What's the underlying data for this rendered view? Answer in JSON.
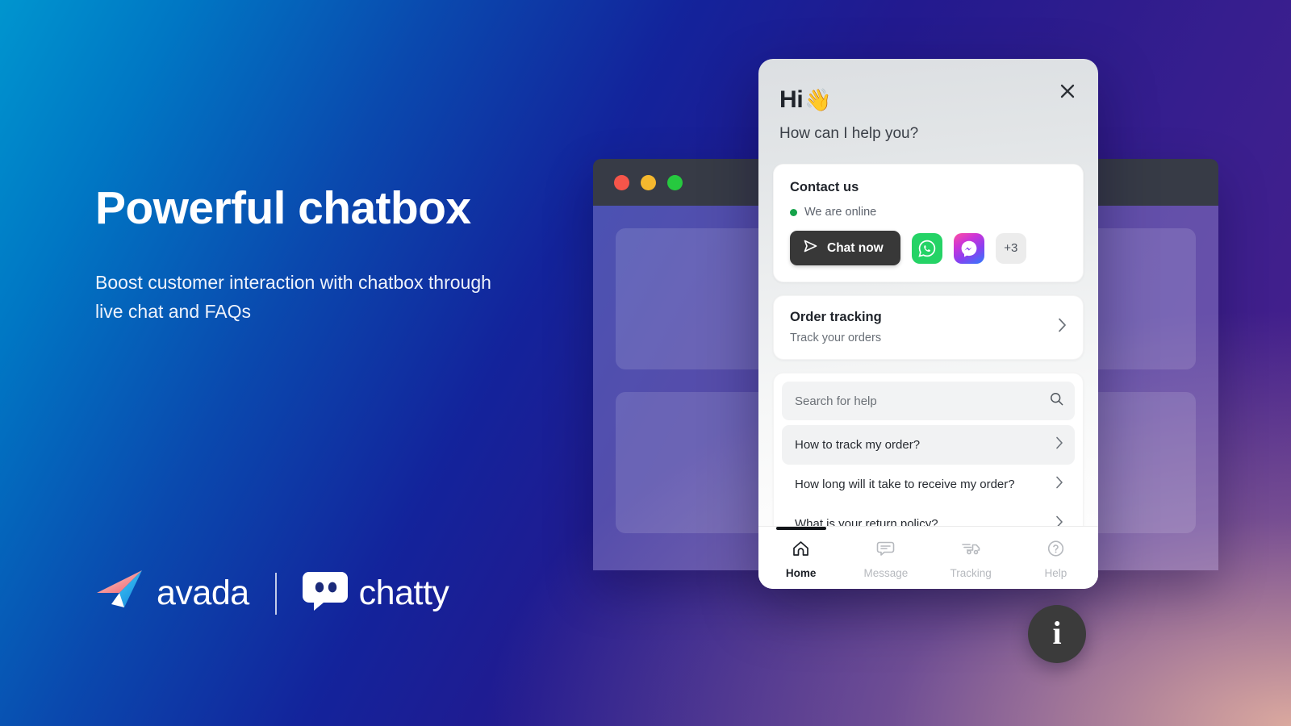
{
  "hero": {
    "headline": "Powerful chatbox",
    "subhead": "Boost customer interaction with chatbox through live chat and FAQs"
  },
  "brand": {
    "avada_word": "avada",
    "avada_logo_icon": "paper-plane-icon",
    "chatty_word": "chatty",
    "chatty_logo_icon": "speech-bubble-face-icon"
  },
  "mockup": {
    "traffic_lights": [
      "close-red",
      "minimize-yellow",
      "maximize-green"
    ],
    "placeholder_cards": [
      "placeholder-block-1",
      "placeholder-block-2"
    ]
  },
  "widget": {
    "close_icon": "close-icon",
    "greeting": "Hi",
    "greeting_emoji": "👋",
    "greeting_sub": "How can I help you?",
    "contact": {
      "title": "Contact us",
      "status": "We are online",
      "status_color": "#16a34a",
      "chat_button": "Chat now",
      "chat_button_icon": "send-icon",
      "channels": [
        {
          "name": "whatsapp-icon",
          "label": ""
        },
        {
          "name": "messenger-icon",
          "label": ""
        },
        {
          "name": "more-channels",
          "label": "+3"
        }
      ]
    },
    "order": {
      "title": "Order tracking",
      "subtitle": "Track your orders",
      "chevron_icon": "chevron-right-icon"
    },
    "help": {
      "search_placeholder": "Search for help",
      "search_value": "",
      "search_icon": "search-icon",
      "faqs": [
        {
          "text": "How to track my order?",
          "active": true
        },
        {
          "text": "How long will it take to receive my order?",
          "active": false
        },
        {
          "text": "What is your return policy?",
          "active": false
        }
      ]
    },
    "nav": [
      {
        "label": "Home",
        "icon": "home-icon",
        "active": true
      },
      {
        "label": "Message",
        "icon": "message-icon",
        "active": false
      },
      {
        "label": "Tracking",
        "icon": "truck-icon",
        "active": false
      },
      {
        "label": "Help",
        "icon": "question-circle-icon",
        "active": false
      }
    ]
  },
  "fab": {
    "icon": "info-icon",
    "glyph": "i"
  }
}
